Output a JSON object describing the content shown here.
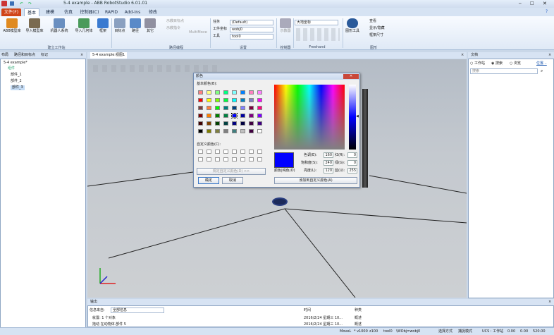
{
  "window": {
    "title": "5-4 example - ABB RobotStudio 6.01.01"
  },
  "tabs": [
    "文件(F)",
    "基本",
    "建模",
    "仿真",
    "控制器(C)",
    "RAPID",
    "Add-Ins",
    "修改"
  ],
  "ribbon": {
    "buttons": [
      "ABB模型库",
      "导入模型库",
      "机器人系统",
      "导入几何体",
      "框架",
      "目标点",
      "路径",
      "其它",
      "MultiMove",
      "示教器",
      "图形工具"
    ],
    "small": [
      "示教目标点",
      "示教指令",
      "查看",
      "显示/隐藏",
      "框架尺寸"
    ],
    "settings_labels": [
      "任务",
      "工件坐标",
      "工具"
    ],
    "settings_values": [
      "(Default)",
      "wobj0",
      "tool0"
    ],
    "freehand_value": "大地坐标",
    "groups": [
      "建立工作站",
      "路径编程",
      "设置",
      "控制器",
      "Freehand",
      "图形"
    ]
  },
  "left_panel": {
    "tabs": [
      "布局",
      "路径和目标点",
      "标记"
    ],
    "tree": [
      "5-4 example*",
      "组件",
      "部件_1",
      "部件_2",
      "部件_3"
    ]
  },
  "view": {
    "tab": "5-4 example:视图1"
  },
  "right_panel": {
    "title": "文档",
    "options": [
      "工作站",
      "搜索",
      "浏览"
    ],
    "link": "位置...",
    "search_placeholder": "搜索"
  },
  "dialog": {
    "title": "颜色",
    "basic_label": "基本颜色(B):",
    "custom_label": "自定义颜色(C):",
    "define_button": "规定自定义颜色(D) >>",
    "ok": "确定",
    "cancel": "取消",
    "fields": [
      {
        "label": "色调(E):",
        "value": "160"
      },
      {
        "label": "饱和度(S):",
        "value": "240"
      },
      {
        "label": "亮度(L):",
        "value": "120"
      },
      {
        "label": "红(R):",
        "value": "0"
      },
      {
        "label": "绿(G):",
        "value": "0"
      },
      {
        "label": "蓝(U):",
        "value": "255"
      }
    ],
    "solid_label": "颜色|纯色(O)",
    "add_button": "添加到自定义颜色(A)",
    "basic_colors": [
      "#ff8080",
      "#ffff80",
      "#80ff80",
      "#00ff80",
      "#80ffff",
      "#0080ff",
      "#ff80c0",
      "#ff80ff",
      "#ff0000",
      "#ffff00",
      "#80ff00",
      "#00ff40",
      "#00ffff",
      "#0080c0",
      "#8080c0",
      "#ff00ff",
      "#804040",
      "#ff8040",
      "#00ff00",
      "#008080",
      "#004080",
      "#8080ff",
      "#800040",
      "#ff0080",
      "#800000",
      "#ff8000",
      "#008000",
      "#008040",
      "#0000ff",
      "#0000a0",
      "#800080",
      "#8000ff",
      "#400000",
      "#804000",
      "#004000",
      "#004040",
      "#000080",
      "#000040",
      "#400040",
      "#400080",
      "#000000",
      "#808000",
      "#808040",
      "#808080",
      "#408080",
      "#c0c0c0",
      "#400040",
      "#ffffff"
    ]
  },
  "output": {
    "title": "输出",
    "source_label": "信息来自:",
    "filter": "全部信息",
    "columns": [
      "时间",
      "种类"
    ],
    "rows": [
      {
        "msg": "就置: 1 个对象",
        "time": "2016/2/24 星期三 10...",
        "kind": "概述"
      },
      {
        "msg": "拖动  在动物体.部件 5",
        "time": "2016/2/24 星期三 10...",
        "kind": "概述"
      }
    ]
  },
  "status": [
    "MoveL",
    "* v1000",
    "z100",
    "tool0",
    "\\WObj=wobj0",
    "选择方式",
    "捕捉模式",
    "UCS : 工作站",
    "0.00",
    "0.00",
    "520.00"
  ]
}
